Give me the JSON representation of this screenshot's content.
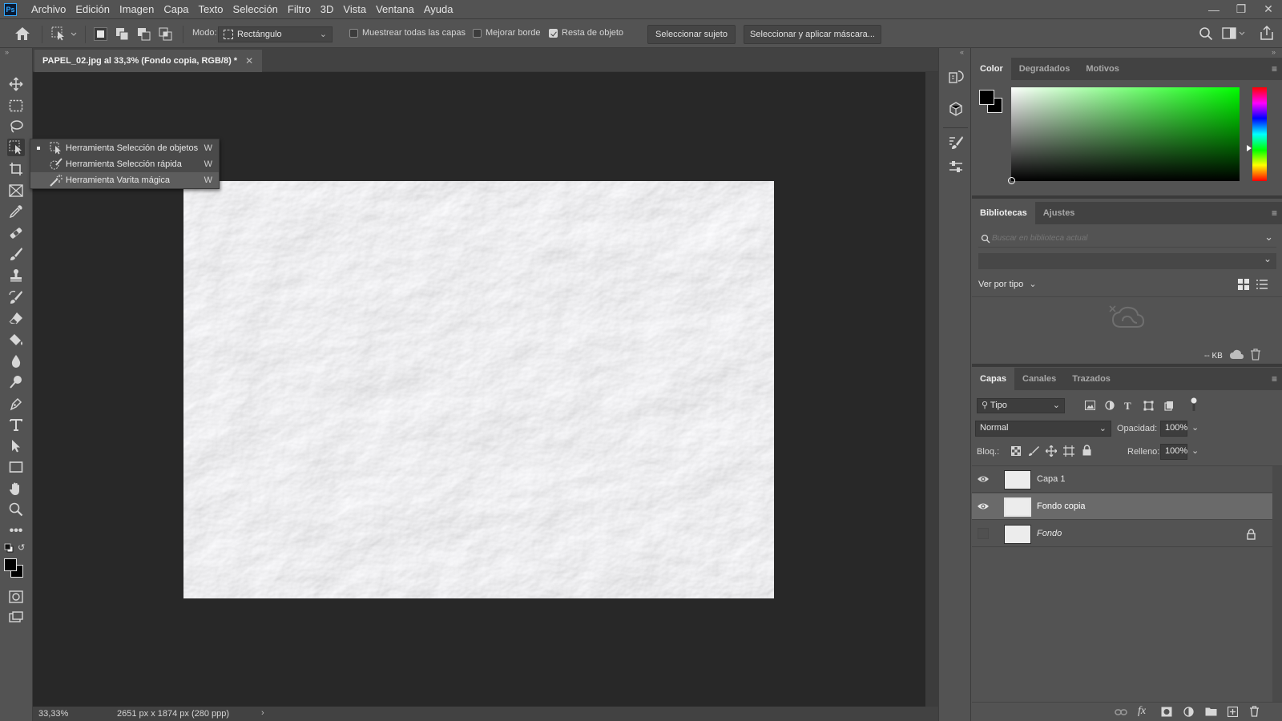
{
  "app": {
    "logo_text": "Ps"
  },
  "menu": [
    "Archivo",
    "Edición",
    "Imagen",
    "Capa",
    "Texto",
    "Selección",
    "Filtro",
    "3D",
    "Vista",
    "Ventana",
    "Ayuda"
  ],
  "options": {
    "mode_label": "Modo:",
    "mode_value": "Rectángulo",
    "sample_all_label": "Muestrear todas las capas",
    "sample_all_checked": false,
    "enhance_edge_label": "Mejorar borde",
    "enhance_edge_checked": false,
    "object_subtract_label": "Resta de objeto",
    "object_subtract_checked": true,
    "select_subject_label": "Seleccionar sujeto",
    "select_and_mask_label": "Seleccionar y aplicar máscara..."
  },
  "document": {
    "tab_title": "PAPEL_02.jpg al 33,3% (Fondo copia, RGB/8) *",
    "zoom": "33,33%",
    "dimensions": "2651 px x 1874 px (280 ppp)"
  },
  "flyout": [
    {
      "label": "Herramienta Selección de objetos",
      "key": "W"
    },
    {
      "label": "Herramienta Selección rápida",
      "key": "W"
    },
    {
      "label": "Herramienta Varita mágica",
      "key": "W"
    }
  ],
  "color_panel": {
    "tabs": [
      "Color",
      "Degradados",
      "Motivos"
    ],
    "foreground": "#000000",
    "background": "#000000",
    "hue_color": "#00ff00"
  },
  "libraries_panel": {
    "tabs": [
      "Bibliotecas",
      "Ajustes"
    ],
    "search_placeholder": "Buscar en biblioteca actual",
    "view_by": "Ver por tipo",
    "size": "-- KB"
  },
  "layers_panel": {
    "tabs": [
      "Capas",
      "Canales",
      "Trazados"
    ],
    "filter": "Tipo",
    "blend_mode": "Normal",
    "opacity_label": "Opacidad:",
    "opacity_value": "100%",
    "lock_label": "Bloq.:",
    "fill_label": "Relleno:",
    "fill_value": "100%",
    "layers": [
      {
        "name": "Capa 1",
        "visible": true,
        "selected": false,
        "locked": false
      },
      {
        "name": "Fondo copia",
        "visible": true,
        "selected": true,
        "locked": false
      },
      {
        "name": "Fondo",
        "visible": false,
        "selected": false,
        "locked": true
      }
    ]
  },
  "colors": {
    "accent": "#31a8ff",
    "ui_bg": "#535353",
    "doc_bg": "#282828"
  }
}
